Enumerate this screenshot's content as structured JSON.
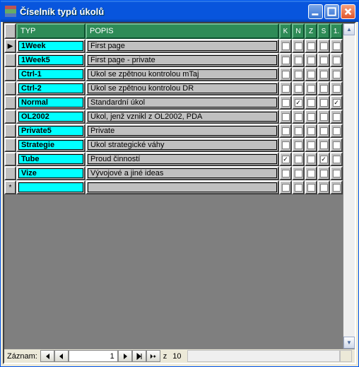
{
  "window": {
    "title": "Číselník typů úkolů"
  },
  "headers": {
    "typ": "TYP",
    "popis": "POPIS",
    "cols": [
      "K",
      "N",
      "Z",
      "S",
      "1."
    ]
  },
  "rows": [
    {
      "typ": "1Week",
      "popis": "First page",
      "c": [
        false,
        false,
        false,
        false,
        false
      ]
    },
    {
      "typ": "1Week5",
      "popis": "First page - private",
      "c": [
        false,
        false,
        false,
        false,
        false
      ]
    },
    {
      "typ": "Ctrl-1",
      "popis": "Úkol se zpětnou kontrolou mTaj",
      "c": [
        false,
        false,
        false,
        false,
        false
      ]
    },
    {
      "typ": "Ctrl-2",
      "popis": "Úkol se zpětnou kontrolou DR",
      "c": [
        false,
        false,
        false,
        false,
        false
      ]
    },
    {
      "typ": "Normal",
      "popis": "Standardní úkol",
      "c": [
        false,
        true,
        false,
        false,
        true
      ]
    },
    {
      "typ": "OL2002",
      "popis": "Úkol, jenž vznikl z OL2002, PDA",
      "c": [
        false,
        false,
        false,
        false,
        false
      ]
    },
    {
      "typ": "Private5",
      "popis": "Private",
      "c": [
        false,
        false,
        false,
        false,
        false
      ]
    },
    {
      "typ": "Strategie",
      "popis": "Úkol strategické váhy",
      "c": [
        false,
        false,
        false,
        false,
        false
      ]
    },
    {
      "typ": "Tube",
      "popis": "Proud činností",
      "c": [
        true,
        false,
        false,
        true,
        false
      ]
    },
    {
      "typ": "Vize",
      "popis": "Vývojové a jiné ideas",
      "c": [
        false,
        false,
        false,
        false,
        false
      ]
    }
  ],
  "blank_row": {
    "typ": "",
    "popis": "",
    "c": [
      false,
      false,
      false,
      false,
      false
    ]
  },
  "nav": {
    "label": "Záznam:",
    "current": "1",
    "sep": "z",
    "total": "10"
  }
}
